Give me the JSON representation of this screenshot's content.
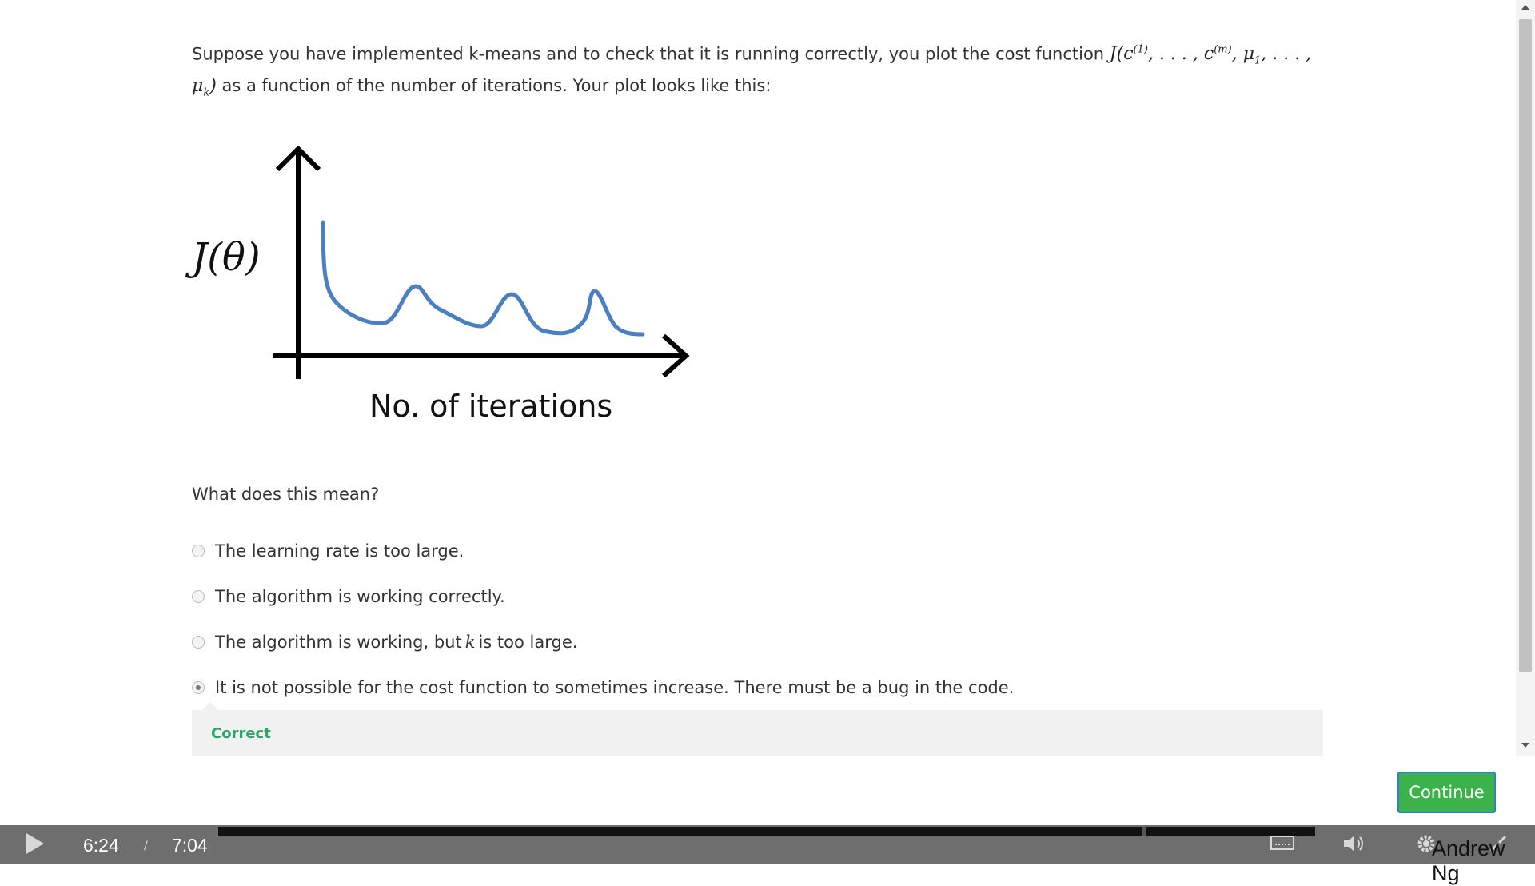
{
  "question": {
    "text_before": "Suppose you have implemented k-means and to check that it is running correctly, you plot the cost function",
    "math": "J(c^(1), ..., c^(m), μ_1, ..., μ_k)",
    "text_after": "as a function of the number of iterations. Your plot looks like this:"
  },
  "figure": {
    "y_label": "J(θ)",
    "x_label": "No. of iterations",
    "curve_color": "#4a7fc1"
  },
  "prompt": "What does this mean?",
  "options": [
    {
      "label": "The learning rate is too large.",
      "selected": false
    },
    {
      "label_before": "The algorithm is working, but",
      "label_math": "k",
      "label_after": "is too large.",
      "selected": false
    },
    {
      "label": "The algorithm is working correctly.",
      "selected": false
    },
    {
      "label": "It is not possible for the cost function to sometimes increase. There must be a bug in the code.",
      "selected": true
    }
  ],
  "feedback": {
    "label": "Correct",
    "color": "#2ea56a"
  },
  "continue_label": "Continue",
  "player": {
    "current_time": "6:24",
    "separator": "/",
    "duration": "7:04",
    "progress_fraction": 0.906,
    "watermark": "Andrew Ng"
  },
  "icons": [
    "play-icon",
    "captions-icon",
    "volume-icon",
    "settings-icon",
    "fullscreen-exit-icon"
  ]
}
